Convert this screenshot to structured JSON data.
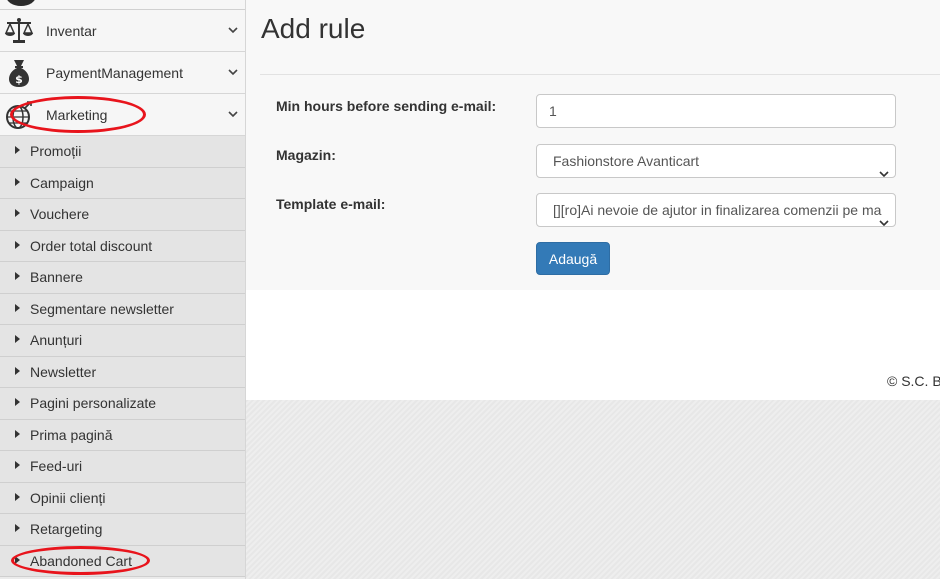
{
  "sidebar": {
    "main_items": [
      {
        "label": "Inventar",
        "icon": "balance-scale-icon"
      },
      {
        "label": "PaymentManagement",
        "icon": "money-bag-icon"
      },
      {
        "label": "Marketing",
        "icon": "globe-marketing-icon"
      }
    ],
    "sub_items": [
      {
        "label": "Promoții"
      },
      {
        "label": "Campaign"
      },
      {
        "label": "Vouchere"
      },
      {
        "label": "Order total discount"
      },
      {
        "label": "Bannere"
      },
      {
        "label": "Segmentare newsletter"
      },
      {
        "label": "Anunțuri"
      },
      {
        "label": "Newsletter"
      },
      {
        "label": "Pagini personalizate"
      },
      {
        "label": "Prima pagină"
      },
      {
        "label": "Feed-uri"
      },
      {
        "label": "Opinii clienți"
      },
      {
        "label": "Retargeting"
      },
      {
        "label": "Abandoned Cart"
      }
    ]
  },
  "main": {
    "title": "Add rule",
    "form": {
      "min_hours_label": "Min hours before sending e-mail:",
      "min_hours_value": "1",
      "store_label": "Magazin:",
      "store_value": "Fashionstore Avanticart",
      "template_label": "Template e-mail:",
      "template_value": "[][ro]Ai nevoie de ajutor in finalizarea comenzii pe ma",
      "submit_label": "Adaugă"
    }
  },
  "footer": {
    "copyright": "© S.C. B"
  },
  "colors": {
    "annotation": "#e8141c",
    "primary_button": "#337ab7"
  }
}
